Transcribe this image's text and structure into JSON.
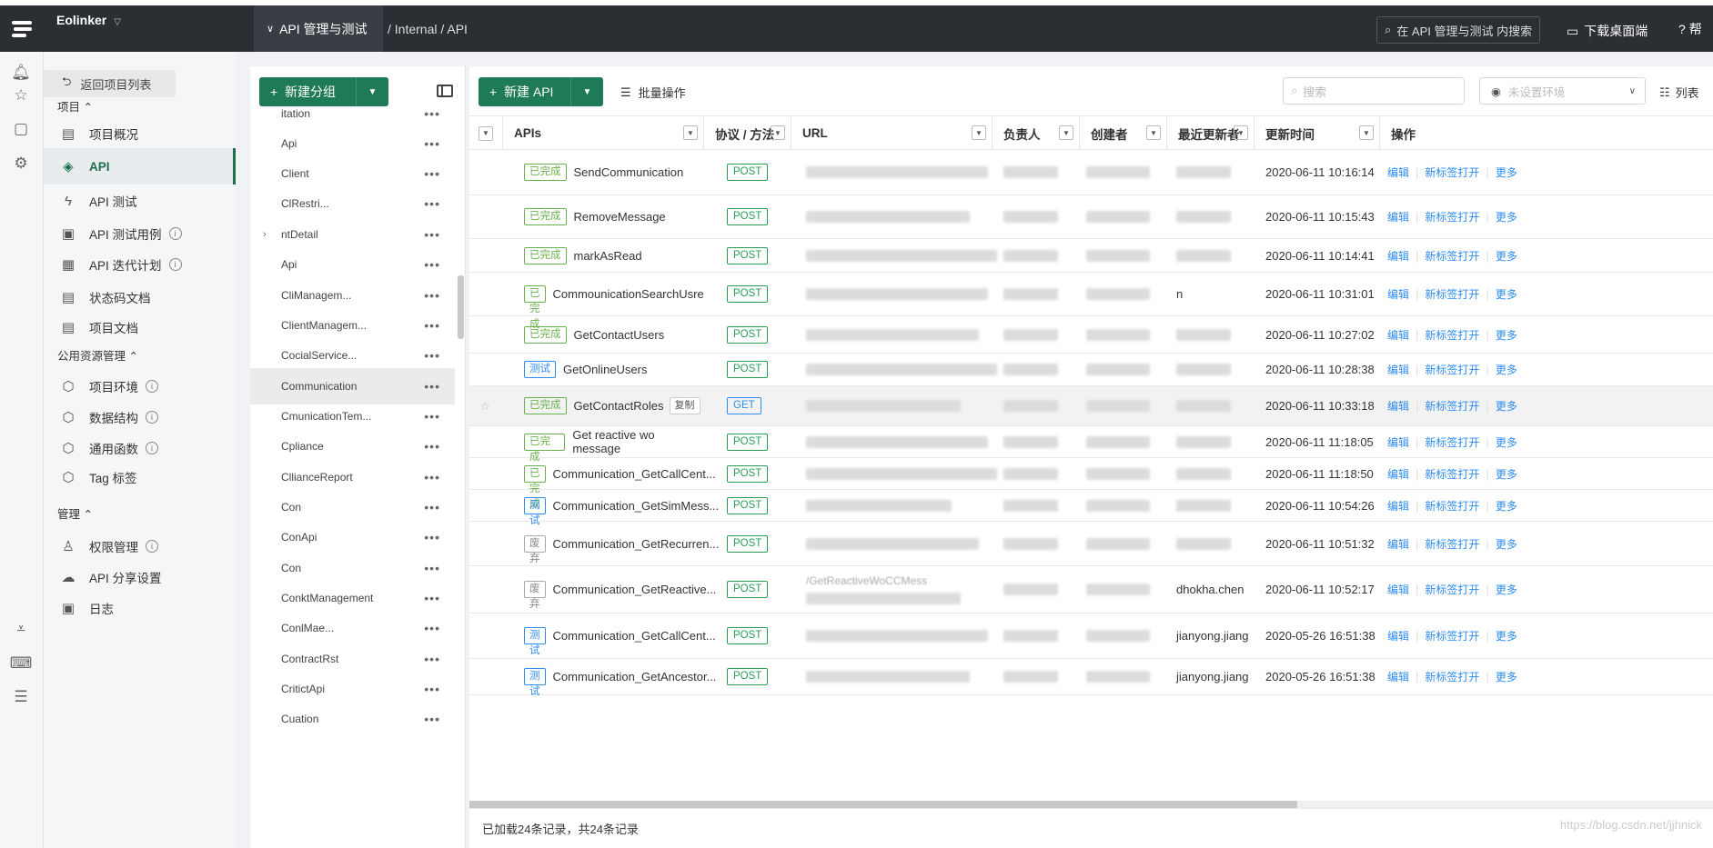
{
  "app": {
    "brand": "Eolinker"
  },
  "header": {
    "project_tab": "API 管理与测试",
    "breadcrumb": "/ Internal / API",
    "search_placeholder": "在 API 管理与测试 内搜索",
    "download": "下载桌面端",
    "help": "帮"
  },
  "nav": {
    "back": "返回项目列表",
    "group_project": "项目",
    "items": [
      {
        "label": "项目概况",
        "icon": "overview-icon"
      },
      {
        "label": "API",
        "icon": "api-tag-icon"
      },
      {
        "label": "API 测试",
        "icon": "lightning-icon"
      },
      {
        "label": "API 测试用例",
        "icon": "testcase-icon"
      },
      {
        "label": "API 迭代计划",
        "icon": "calendar-icon"
      },
      {
        "label": "状态码文档",
        "icon": "doc-icon"
      },
      {
        "label": "项目文档",
        "icon": "doc-icon"
      }
    ],
    "group_public": "公用资源管理",
    "public_items": [
      {
        "label": "项目环境"
      },
      {
        "label": "数据结构"
      },
      {
        "label": "通用函数"
      },
      {
        "label": "Tag 标签"
      }
    ],
    "group_admin": "管理",
    "admin_items": [
      {
        "label": "权限管理"
      },
      {
        "label": "API 分享设置"
      },
      {
        "label": "日志"
      }
    ]
  },
  "tree": {
    "new_group": "新建分组",
    "items": [
      "itation",
      "Api",
      "Client",
      "ClRestri...",
      "ntDetail",
      "Api",
      "CliManagem...",
      "ClientManagem...",
      "CocialService...",
      "Communication",
      "CmunicationTem...",
      "Cpliance",
      "CllianceReport",
      "Con",
      "ConApi",
      "Con",
      "ConktManagement",
      "ConlMae...",
      "ContractRst",
      "CritictApi",
      "Cuation"
    ],
    "selected": "Communication"
  },
  "toolbar": {
    "new_api": "新建 API",
    "batch": "批量操作",
    "search_placeholder": "搜索",
    "env_placeholder": "未设置环境",
    "list_view": "列表"
  },
  "table": {
    "headers": [
      "APIs",
      "协议 / 方法",
      "URL",
      "负责人",
      "创建者",
      "最近更新者",
      "更新时间",
      "操作"
    ],
    "rows": [
      {
        "status": "已完成",
        "name": "SendCommunication",
        "method": "POST",
        "updater": "",
        "time": "2020-06-11 10:16:14"
      },
      {
        "status": "已完成",
        "name": "RemoveMessage",
        "method": "POST",
        "updater": "",
        "time": "2020-06-11 10:15:43"
      },
      {
        "status": "已完成",
        "name": "markAsRead",
        "method": "POST",
        "updater": "",
        "time": "2020-06-11 10:14:41"
      },
      {
        "status": "已完成",
        "name": "CommounicationSearchUsre",
        "method": "POST",
        "updater": "n",
        "time": "2020-06-11 10:31:01"
      },
      {
        "status": "已完成",
        "name": "GetContactUsers",
        "method": "POST",
        "updater": "",
        "time": "2020-06-11 10:27:02"
      },
      {
        "status": "测试",
        "name": "GetOnlineUsers",
        "method": "POST",
        "updater": "",
        "time": "2020-06-11 10:28:38"
      },
      {
        "status": "已完成",
        "name": "GetContactRoles",
        "method": "GET",
        "updater": "",
        "time": "2020-06-11 10:33:18",
        "copy": "复制"
      },
      {
        "status": "已完成",
        "name": "Get reactive wo message",
        "method": "POST",
        "updater": "",
        "time": "2020-06-11 11:18:05"
      },
      {
        "status": "已完成",
        "name": "Communication_GetCallCent...",
        "method": "POST",
        "updater": "",
        "time": "2020-06-11 11:18:50"
      },
      {
        "status": "测试",
        "name": "Communication_GetSimMess...",
        "method": "POST",
        "updater": "",
        "time": "2020-06-11 10:54:26"
      },
      {
        "status": "废弃",
        "name": "Communication_GetRecurren...",
        "method": "POST",
        "updater": "",
        "time": "2020-06-11 10:51:32"
      },
      {
        "status": "废弃",
        "name": "Communication_GetReactive...",
        "method": "POST",
        "updater": "dhokha.chen",
        "time": "2020-06-11 10:52:17",
        "url": "/GetReactiveWoCCMess"
      },
      {
        "status": "测试",
        "name": "Communication_GetCallCent...",
        "method": "POST",
        "updater": "jianyong.jiang",
        "time": "2020-05-26 16:51:38"
      },
      {
        "status": "测试",
        "name": "Communication_GetAncestor...",
        "method": "POST",
        "updater": "jianyong.jiang",
        "time": "2020-05-26 16:51:38"
      }
    ],
    "op_edit": "编辑",
    "op_newtab": "新标签打开",
    "op_more": "更多"
  },
  "footer": {
    "summary": "已加载24条记录，共24条记录"
  },
  "watermark": "https://blog.csdn.net/jjhnick",
  "colors": {
    "primary": "#1f7a57",
    "link": "#2d8cf0",
    "done": "#6ab04c"
  }
}
